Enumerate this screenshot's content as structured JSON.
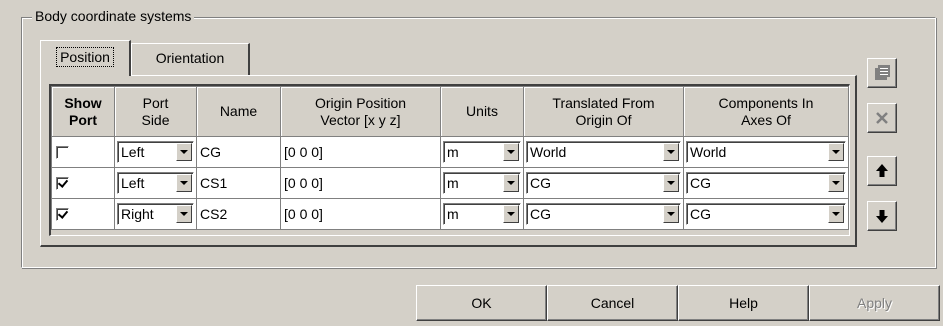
{
  "groupbox": {
    "title": "Body coordinate systems"
  },
  "tabs": [
    {
      "label": "Position",
      "active": true
    },
    {
      "label": "Orientation",
      "active": false
    }
  ],
  "table": {
    "headers": {
      "show_port": [
        "Show",
        "Port"
      ],
      "port_side": [
        "Port",
        "Side"
      ],
      "name": [
        "Name"
      ],
      "origin": [
        "Origin Position",
        "Vector [x y z]"
      ],
      "units": [
        "Units"
      ],
      "translated": [
        "Translated From",
        "Origin Of"
      ],
      "components": [
        "Components In",
        "Axes Of"
      ]
    },
    "rows": [
      {
        "show_port": false,
        "port_side": "Left",
        "name": "CG",
        "origin": "[0 0 0]",
        "units": "m",
        "translated": "World",
        "components": "World"
      },
      {
        "show_port": true,
        "port_side": "Left",
        "name": "CS1",
        "origin": "[0 0 0]",
        "units": "m",
        "translated": "CG",
        "components": "CG"
      },
      {
        "show_port": true,
        "port_side": "Right",
        "name": "CS2",
        "origin": "[0 0 0]",
        "units": "m",
        "translated": "CG",
        "components": "CG"
      }
    ]
  },
  "side_buttons": [
    {
      "icon": "add-coordinate-system-icon",
      "enabled": false
    },
    {
      "icon": "delete-x-icon",
      "enabled": false
    },
    {
      "icon": "move-up-arrow-icon",
      "enabled": true
    },
    {
      "icon": "move-down-arrow-icon",
      "enabled": true
    }
  ],
  "dialog_buttons": {
    "ok": "OK",
    "cancel": "Cancel",
    "help": "Help",
    "apply": "Apply"
  }
}
